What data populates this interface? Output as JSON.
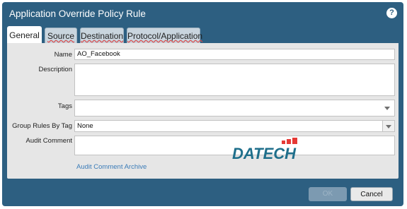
{
  "dialog": {
    "title": "Application Override Policy Rule",
    "help_icon": "question-mark-icon"
  },
  "tabs": [
    {
      "label": "General",
      "active": true
    },
    {
      "label": "Source",
      "active": false
    },
    {
      "label": "Destination",
      "active": false
    },
    {
      "label": "Protocol/Application",
      "active": false
    }
  ],
  "form": {
    "name_label": "Name",
    "name_value": "AO_Facebook",
    "description_label": "Description",
    "description_value": "",
    "tags_label": "Tags",
    "tags_value": "",
    "group_rules_label": "Group Rules By Tag",
    "group_rules_value": "None",
    "audit_comment_label": "Audit Comment",
    "audit_comment_value": "",
    "audit_archive_link": "Audit Comment Archive"
  },
  "watermark": {
    "text": "DATECH",
    "colors": {
      "text": "#1f6f8b",
      "accent": "#e53935"
    }
  },
  "buttons": {
    "ok_label": "OK",
    "cancel_label": "Cancel"
  },
  "colors": {
    "dialog_bg": "#2d5f81",
    "panel_bg": "#e6e6e6",
    "link": "#3b7cb8"
  }
}
